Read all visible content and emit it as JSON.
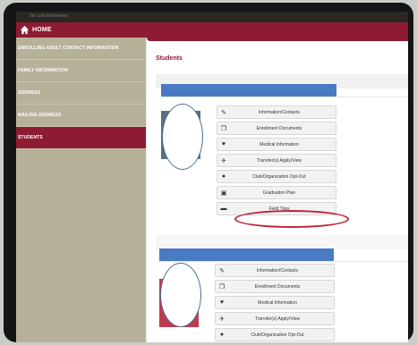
{
  "topbar": {
    "caption": "Tab Left Elementary"
  },
  "home": {
    "label": "HOME",
    "icon": "home-icon"
  },
  "sidebar": {
    "items": [
      {
        "label": "ENROLLING ADULT CONTACT INFORMATION",
        "active": false
      },
      {
        "label": "FAMILY INFORMATION",
        "active": false
      },
      {
        "label": "ADDRESS",
        "active": false
      },
      {
        "label": "MAILING ADDRESS",
        "active": false
      },
      {
        "label": "STUDENTS",
        "active": true
      }
    ]
  },
  "main": {
    "title": "Students",
    "students": [
      {
        "actions": [
          {
            "label": "Information/Contacts",
            "icon": "pencil-icon"
          },
          {
            "label": "Enrollment Documents",
            "icon": "documents-icon"
          },
          {
            "label": "Medical Information",
            "icon": "stethoscope-icon"
          },
          {
            "label": "Transfer(s) Apply/View",
            "icon": "plane-icon"
          },
          {
            "label": "Club/Organization Opt-Out",
            "icon": "user-icon"
          },
          {
            "label": "Graduation Plan",
            "icon": "mortarboard-icon"
          },
          {
            "label": "Field Trips",
            "icon": "bus-icon"
          }
        ]
      },
      {
        "actions": [
          {
            "label": "Information/Contacts",
            "icon": "pencil-icon"
          },
          {
            "label": "Enrollment Documents",
            "icon": "documents-icon"
          },
          {
            "label": "Medical Information",
            "icon": "stethoscope-icon"
          },
          {
            "label": "Transfer(s) Apply/View",
            "icon": "plane-icon"
          },
          {
            "label": "Club/Organization Opt-Out",
            "icon": "user-icon"
          }
        ]
      }
    ]
  },
  "colors": {
    "brand": "#8d1b32",
    "sidebar": "#b7b19a",
    "card_header": "#4a7ac4",
    "highlight": "#c0223b"
  }
}
